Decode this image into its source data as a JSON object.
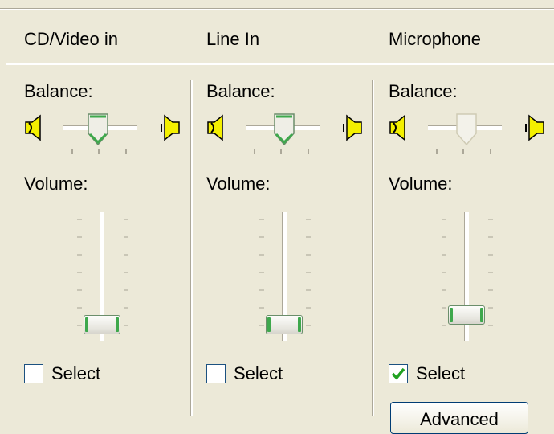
{
  "columns": [
    {
      "title": "CD/Video in",
      "balance_label": "Balance:",
      "volume_label": "Volume:",
      "volume_level": 0.0,
      "balance_level": 0.5,
      "select_label": "Select",
      "selected": false
    },
    {
      "title": "Line In",
      "balance_label": "Balance:",
      "volume_label": "Volume:",
      "volume_level": 0.0,
      "balance_level": 0.5,
      "select_label": "Select",
      "selected": false
    },
    {
      "title": "Microphone",
      "balance_label": "Balance:",
      "volume_label": "Volume:",
      "volume_level": 0.2,
      "balance_level": 0.5,
      "select_label": "Select",
      "selected": true
    }
  ],
  "advanced_label": "Advanced",
  "colors": {
    "face": "#ece9d8",
    "accent_green": "#3ea84c",
    "speaker_yellow": "#f4f000",
    "check_green": "#21a121"
  }
}
